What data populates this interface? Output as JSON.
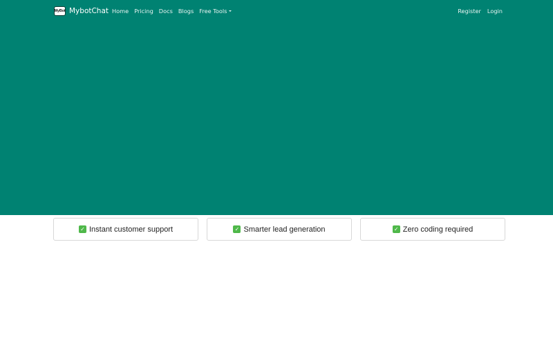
{
  "brand": {
    "logo_text": "MyBot",
    "name": "MybotChat"
  },
  "nav": {
    "left": [
      {
        "label": "Home"
      },
      {
        "label": "Pricing"
      },
      {
        "label": "Docs"
      },
      {
        "label": "Blogs"
      },
      {
        "label": "Free Tools",
        "dropdown": true
      }
    ],
    "right": [
      {
        "label": "Register"
      },
      {
        "label": "Login"
      }
    ]
  },
  "features": [
    {
      "icon": "check-mark-icon",
      "text": "Instant customer support"
    },
    {
      "icon": "check-mark-icon",
      "text": "Smarter lead generation"
    },
    {
      "icon": "check-mark-icon",
      "text": "Zero coding required"
    }
  ],
  "colors": {
    "hero_bg": "#008272",
    "check_green": "#4fb84a"
  }
}
